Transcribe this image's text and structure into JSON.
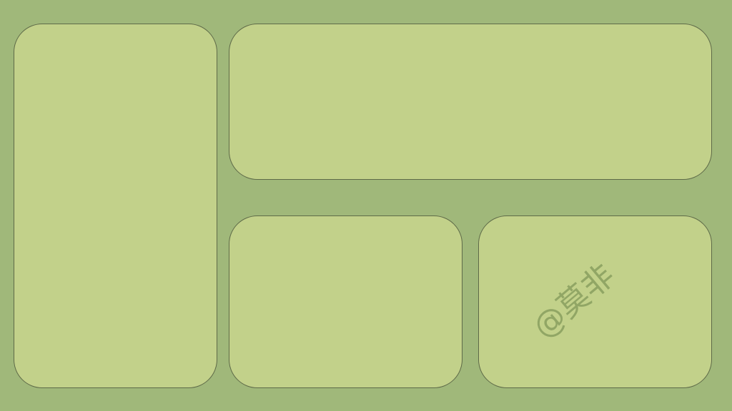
{
  "watermark": {
    "text": "@莫非"
  }
}
